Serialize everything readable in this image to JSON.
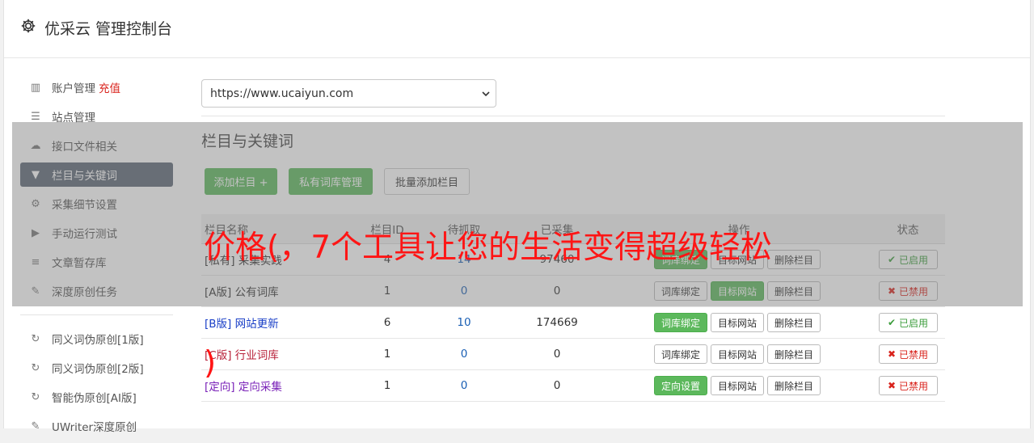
{
  "header": {
    "title": "优采云 管理控制台"
  },
  "sidebar": {
    "items": [
      {
        "label": "账户管理",
        "extra": "充值",
        "icon": "bar-chart-icon"
      },
      {
        "label": "站点管理",
        "icon": "server-icon"
      },
      {
        "label": "接口文件相关",
        "icon": "cloud-upload-icon"
      },
      {
        "label": "栏目与关键词",
        "icon": "filter-icon",
        "active": true
      },
      {
        "label": "采集细节设置",
        "icon": "cogs-icon"
      },
      {
        "label": "手动运行测试",
        "icon": "play-circle-icon"
      },
      {
        "label": "文章暂存库",
        "icon": "database-icon"
      },
      {
        "label": "深度原创任务",
        "icon": "edit-icon"
      }
    ],
    "items2": [
      {
        "label": "同义词伪原创[1版]",
        "icon": "refresh-icon"
      },
      {
        "label": "同义词伪原创[2版]",
        "icon": "refresh-icon"
      },
      {
        "label": "智能伪原创[AI版]",
        "icon": "refresh-icon"
      },
      {
        "label": "UWriter深度原创",
        "icon": "edit-icon"
      }
    ]
  },
  "main": {
    "site_select": "https://www.ucaiyun.com",
    "section_title": "栏目与关键词",
    "buttons": {
      "add": "添加栏目 +",
      "private_lib": "私有词库管理",
      "batch_add": "批量添加栏目"
    },
    "table": {
      "headers": {
        "name": "栏目名称",
        "id": "栏目ID",
        "pending": "待抓取",
        "collected": "已采集",
        "ops": "操作",
        "state": "状态"
      },
      "rows": [
        {
          "tag": "[私有]",
          "name": "采集实践",
          "id": "4",
          "pending": "14",
          "collected": "97460",
          "op1": "词库绑定",
          "op2": "目标网站",
          "op3": "删除栏目",
          "state": "已启用",
          "on": true,
          "tag_color": "#333"
        },
        {
          "tag": "[A版]",
          "name": "公有词库",
          "id": "1",
          "pending": "0",
          "collected": "0",
          "op1": "词库绑定",
          "op2": "目标网站",
          "op3": "删除栏目",
          "state": "已禁用",
          "on": false,
          "tag_color": "#333"
        },
        {
          "tag": "[B版]",
          "name": "网站更新",
          "id": "6",
          "pending": "10",
          "collected": "174669",
          "op1": "词库绑定",
          "op2": "目标网站",
          "op3": "删除栏目",
          "state": "已启用",
          "on": true,
          "tag_color": "#1a3fc7"
        },
        {
          "tag": "[C版]",
          "name": "行业词库",
          "id": "1",
          "pending": "0",
          "collected": "0",
          "op1": "词库绑定",
          "op2": "目标网站",
          "op3": "删除栏目",
          "state": "已禁用",
          "on": false,
          "tag_color": "#b8213a"
        },
        {
          "tag": "[定向]",
          "name": "定向采集",
          "id": "1",
          "pending": "0",
          "collected": "0",
          "op1": "定向设置",
          "op2": "目标网站",
          "op3": "删除栏目",
          "state": "已禁用",
          "on": false,
          "tag_color": "#7a22b8"
        }
      ]
    }
  },
  "overlay_text": {
    "line1": "价格(，7个工具让您的生活变得超级轻松",
    "line2": ")"
  },
  "colors": {
    "green": "#5cb85c",
    "red": "#d9231c",
    "active_nav": "#5c6775",
    "ad_red": "#ff1515"
  }
}
